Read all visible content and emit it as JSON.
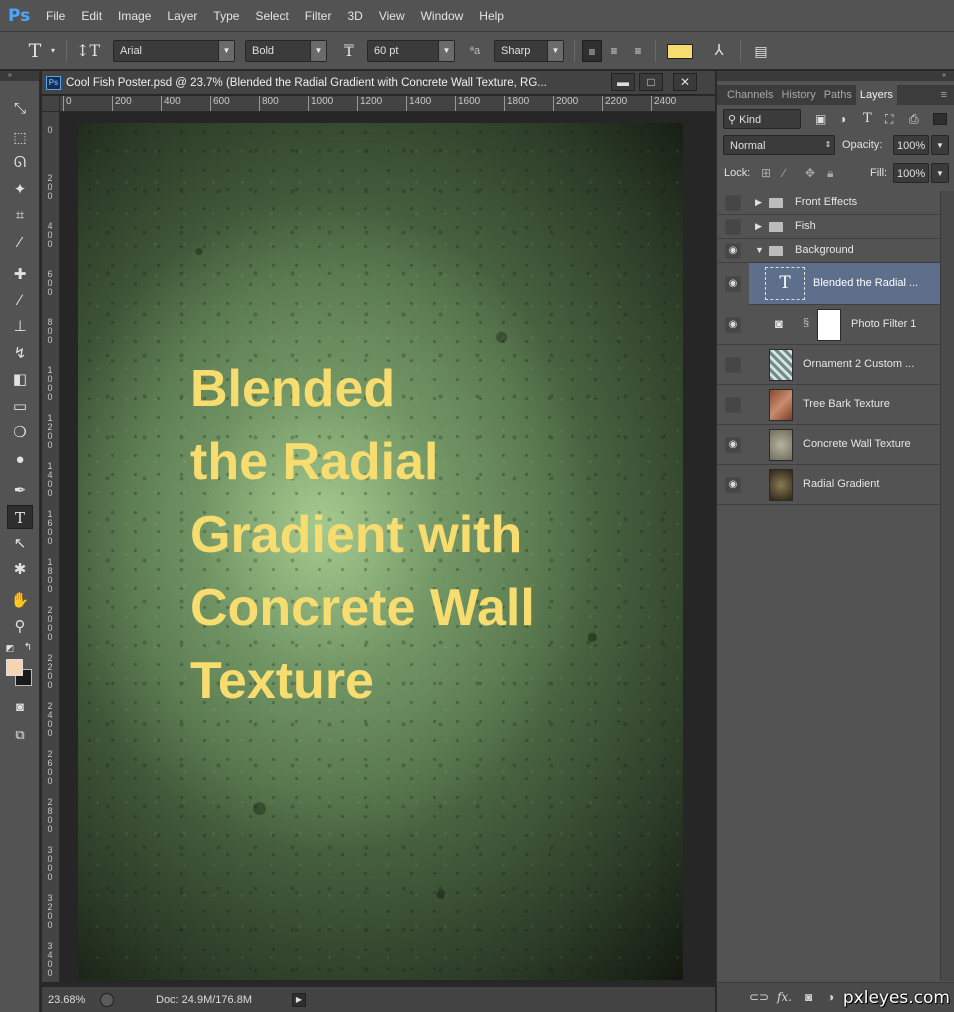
{
  "app": {
    "logo": "Ps"
  },
  "menu": [
    "File",
    "Edit",
    "Image",
    "Layer",
    "Type",
    "Select",
    "Filter",
    "3D",
    "View",
    "Window",
    "Help"
  ],
  "options": {
    "font_family": "Arial",
    "font_style": "Bold",
    "font_size": "60 pt",
    "aa_label": "a",
    "antialias": "Sharp",
    "text_color": "#f7dc6f"
  },
  "document": {
    "title": "Cool Fish Poster.psd @ 23.7% (Blended the Radial Gradient with Concrete Wall Texture, RG...",
    "ruler_h": [
      "0",
      "200",
      "400",
      "600",
      "800",
      "1000",
      "1200",
      "1400",
      "1600",
      "1800",
      "2000",
      "2200",
      "2400"
    ],
    "ruler_v": [
      "0",
      "2 0 0",
      "4 0 0",
      "6 0 0",
      "8 0 0",
      "1 0 0 0",
      "1 2 0 0",
      "1 4 0 0",
      "1 6 0 0",
      "1 8 0 0",
      "2 0 0 0",
      "2 2 0 0",
      "2 4 0 0",
      "2 6 0 0",
      "2 8 0 0",
      "3 0 0 0",
      "3 2 0 0",
      "3 4 0 0"
    ],
    "poster_lines": [
      "Blended",
      "the Radial",
      "Gradient with",
      "Concrete Wall",
      "Texture"
    ],
    "zoom": "23.68%",
    "doc_info": "Doc: 24.9M/176.8M"
  },
  "panel": {
    "tabs": [
      "Channels",
      "History",
      "Paths",
      "Layers"
    ],
    "active_tab": "Layers",
    "filter_kind": "Kind",
    "blend_mode": "Normal",
    "opacity_label": "Opacity:",
    "opacity": "100%",
    "lock_label": "Lock:",
    "fill_label": "Fill:",
    "fill": "100%"
  },
  "layers": [
    {
      "name": "Front Effects",
      "type": "group",
      "visible": false,
      "collapsed": true
    },
    {
      "name": "Fish",
      "type": "group",
      "visible": false,
      "collapsed": true
    },
    {
      "name": "Background",
      "type": "group",
      "visible": true,
      "collapsed": false
    },
    {
      "name": "Blended the Radial ...",
      "type": "text",
      "visible": true,
      "selected": true
    },
    {
      "name": "Photo Filter 1",
      "type": "adjustment",
      "visible": true
    },
    {
      "name": "Ornament 2 Custom ...",
      "type": "image",
      "visible": false
    },
    {
      "name": "Tree Bark Texture",
      "type": "image",
      "visible": false
    },
    {
      "name": "Concrete Wall Texture",
      "type": "image",
      "visible": true
    },
    {
      "name": "Radial Gradient",
      "type": "image",
      "visible": true
    }
  ],
  "watermark": "pxleyes.com"
}
